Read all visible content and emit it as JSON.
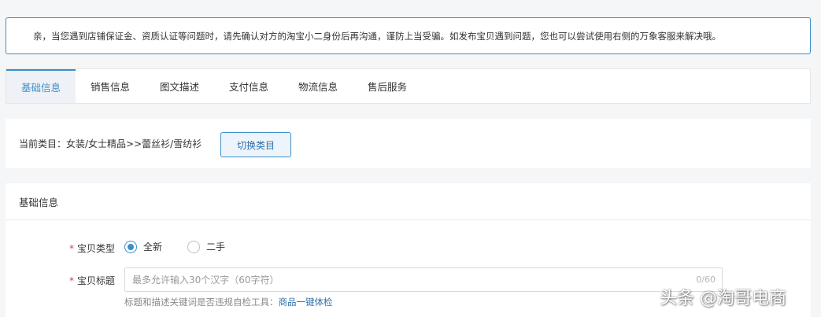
{
  "notice": {
    "text": "亲，当您遇到店铺保证金、资质认证等问题时，请先确认对方的淘宝小二身份后再沟通，谨防上当受骗。如发布宝贝遇到问题，您也可以尝试使用右侧的万象客服来解决哦。"
  },
  "tabs": [
    {
      "label": "基础信息",
      "active": true
    },
    {
      "label": "销售信息"
    },
    {
      "label": "图文描述"
    },
    {
      "label": "支付信息"
    },
    {
      "label": "物流信息"
    },
    {
      "label": "售后服务"
    }
  ],
  "category": {
    "label": "当前类目：",
    "path": "女装/女士精品>>蕾丝衫/雪纺衫",
    "switch_label": "切换类目"
  },
  "basic": {
    "header": "基础信息",
    "item_type": {
      "required": "*",
      "label": "宝贝类型",
      "options": [
        {
          "label": "全新",
          "checked": true
        },
        {
          "label": "二手",
          "checked": false
        }
      ]
    },
    "title": {
      "required": "*",
      "label": "宝贝标题",
      "placeholder": "最多允许输入30个汉字（60字符）",
      "counter": "0/60",
      "helper_text": "标题和描述关键词是否违规自检工具：",
      "helper_link": "商品一键体检"
    }
  },
  "watermark": "头条 @淘哥电商",
  "colors": {
    "accent": "#3a8fc9",
    "required": "#e4393c",
    "link": "#2f6fa8"
  }
}
